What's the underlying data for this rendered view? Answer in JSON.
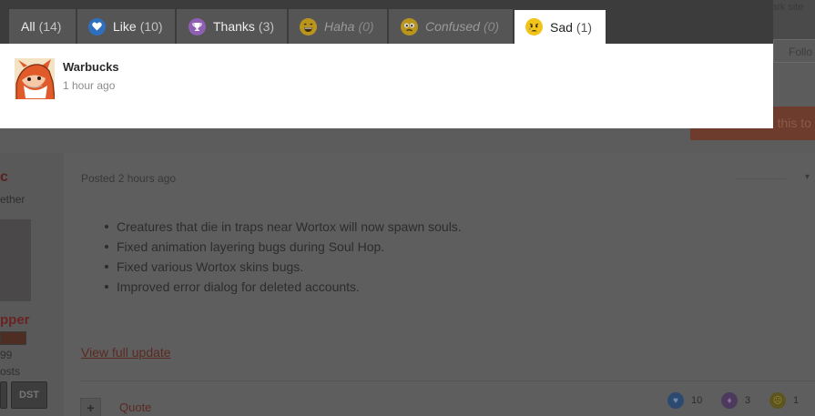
{
  "dialog": {
    "tabs": [
      {
        "label": "All",
        "count": "(14)",
        "icon": ""
      },
      {
        "label": "Like",
        "count": "(10)",
        "icon": "heart-icon"
      },
      {
        "label": "Thanks",
        "count": "(3)",
        "icon": "trophy-icon"
      },
      {
        "label": "Haha",
        "count": "(0)",
        "icon": "laughing-face-icon"
      },
      {
        "label": "Confused",
        "count": "(0)",
        "icon": "confused-face-icon"
      },
      {
        "label": "Sad",
        "count": "(1)",
        "icon": "sad-face-icon"
      }
    ],
    "active_tab": "Sad",
    "reactors": [
      {
        "name": "Warbucks",
        "time": "1 hour ago"
      }
    ]
  },
  "background": {
    "top_right_text": "ark site",
    "follow_label": "Follo",
    "orange_button_label": "to this to",
    "user_fragment": "c",
    "user_sub": "ether",
    "username": "pper",
    "rank_num": "99",
    "posts_label": "osts",
    "badge_text": "DST",
    "posted_label": "Posted 2 hours ago",
    "bullets": [
      "Creatures that die in traps near Wortox will now spawn souls.",
      "Fixed animation layering bugs during Soul Hop.",
      "Fixed various Wortox skins bugs.",
      "Improved error dialog for deleted accounts."
    ],
    "view_full_update": "View full update",
    "quote_label": "Quote",
    "plus_label": "+",
    "reactions": [
      {
        "icon": "heart-icon",
        "count": "10"
      },
      {
        "icon": "trophy-icon",
        "count": "3"
      },
      {
        "icon": "sad-face-icon",
        "count": "1"
      }
    ]
  },
  "colors": {
    "overlay_tab_bar": "#3c3c3c",
    "tab_inactive": "#555555",
    "tab_active": "#ffffff",
    "like_blue": "#2f6fbf",
    "thanks_purple": "#8e5fb3",
    "emoji_yellow": "#f2c318"
  }
}
